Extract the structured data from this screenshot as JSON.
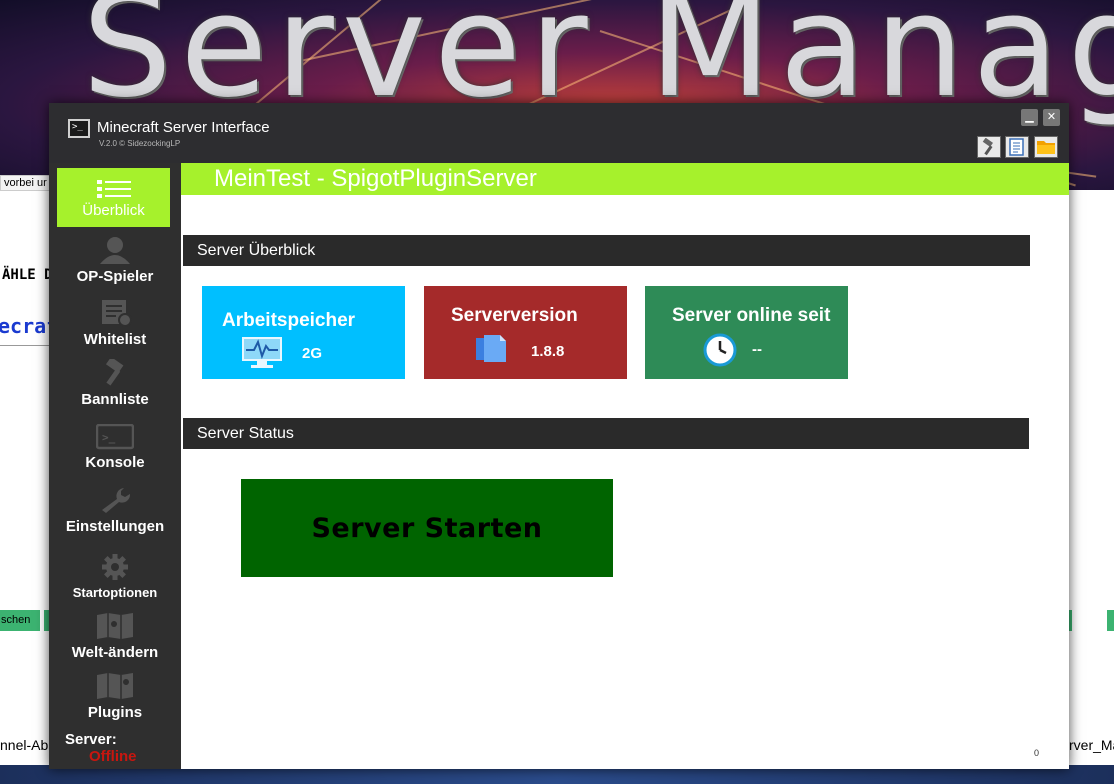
{
  "background": {
    "banner_text": "Server Manage",
    "fragments": [
      "vorbei ur",
      "ÄHLE D",
      "ecraft",
      "schen",
      "nnel-Ab",
      "rver_Ma"
    ]
  },
  "window": {
    "title": "Minecraft Server Interface",
    "version": "V.2.0 © SidezockingLP",
    "minimize_label": "▁",
    "close_label": "✕"
  },
  "toolbar": {
    "icons": [
      "hammer-icon",
      "notes-icon",
      "folder-icon"
    ]
  },
  "sidebar": {
    "items": [
      {
        "label": "Überblick",
        "icon": "list-icon",
        "active": true
      },
      {
        "label": "OP-Spieler",
        "icon": "person-icon"
      },
      {
        "label": "Whitelist",
        "icon": "whitelist-icon"
      },
      {
        "label": "Bannliste",
        "icon": "ban-hammer-icon"
      },
      {
        "label": "Konsole",
        "icon": "console-icon"
      },
      {
        "label": "Einstellungen",
        "icon": "wrench-icon"
      },
      {
        "label": "Startoptionen",
        "icon": "gear-icon"
      },
      {
        "label": "Welt-ändern",
        "icon": "map-icon"
      },
      {
        "label": "Plugins",
        "icon": "plugin-map-icon"
      }
    ],
    "server_label": "Server:",
    "server_status": "Offline"
  },
  "header": {
    "server_name": "MeinTest - SpigotPluginServer"
  },
  "overview": {
    "section_title": "Server Überblick",
    "tiles": [
      {
        "title": "Arbeitspeicher",
        "value": "2G",
        "color": "#00bfff",
        "icon": "monitor-pulse-icon"
      },
      {
        "title": "Serverversion",
        "value": "1.8.8",
        "color": "#a52a2a",
        "icon": "documents-icon"
      },
      {
        "title": "Server online seit",
        "value": "--",
        "color": "#2e8b57",
        "icon": "clock-icon"
      }
    ]
  },
  "status": {
    "section_title": "Server Status",
    "start_button_label": "Server Starten",
    "start_button_color": "#006400"
  },
  "footer": {
    "corner_value": "0"
  },
  "colors": {
    "accent": "#a6f12c",
    "sidebar": "#2f2f2f",
    "titlebar": "#2d2d30",
    "offline": "#c8160f"
  }
}
